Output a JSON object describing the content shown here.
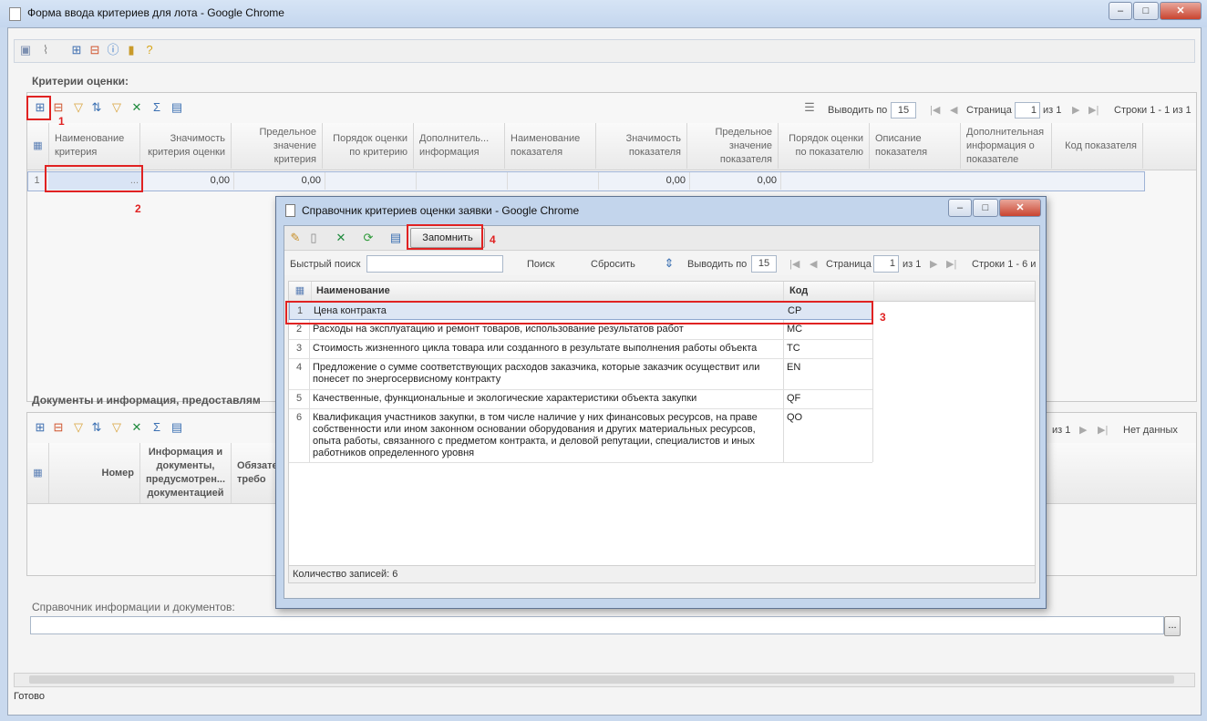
{
  "window": {
    "title": "Форма ввода критериев для лота - Google Chrome",
    "minimize": "–",
    "maximize": "□",
    "close": "✕"
  },
  "toolbar_icons": [
    "save-icon",
    "attach-icon",
    "add-row-icon",
    "delete-row-icon",
    "info-icon",
    "lock-icon",
    "help-icon"
  ],
  "criteria": {
    "title": "Критерии оценки:",
    "pager": {
      "show_label": "Выводить по",
      "show_value": "15",
      "page_label": "Страница",
      "page_value": "1",
      "of": "из 1",
      "rows": "Строки 1 - 1 из 1"
    },
    "columns": [
      "Наименование критерия",
      "Значимость критерия оценки",
      "Предельное значение критерия",
      "Порядок оценки по критерию",
      "Дополнитель... информация",
      "Наименование показателя",
      "Значимость показателя",
      "Предельное значение показателя",
      "Порядок оценки по показателю",
      "Описание показателя",
      "Дополнительная информация о показателе",
      "Код показателя"
    ],
    "row": {
      "num": "1",
      "name": "...",
      "significance": "0,00",
      "limit": "0,00",
      "ind_significance": "0,00",
      "ind_limit": "0,00"
    }
  },
  "documents": {
    "title": "Документы и информация, предоставлям",
    "pager": {
      "of": "из 1",
      "rows": "Нет данных"
    },
    "columns": [
      "Номер",
      "Информация и документы, предусмотрен... документацией",
      "Обязате... требо"
    ]
  },
  "reference": {
    "label": "Справочник информации и документов:",
    "button": "..."
  },
  "status": "Готово",
  "annotations": [
    "1",
    "2",
    "3",
    "4"
  ],
  "dialog": {
    "title": "Справочник критериев оценки заявки - Google Chrome",
    "remember_button": "Запомнить",
    "search_label": "Быстрый поиск",
    "search_value": "",
    "search_button": "Поиск",
    "reset_button": "Сбросить",
    "show_label": "Выводить по",
    "show_value": "15",
    "page_label": "Страница",
    "page_value": "1",
    "of": "из 1",
    "rows": "Строки 1 - 6 и",
    "col_name": "Наименование",
    "col_code": "Код",
    "items": [
      {
        "n": "1",
        "name": "Цена контракта",
        "code": "CP"
      },
      {
        "n": "2",
        "name": "Расходы на эксплуатацию и ремонт товаров, использование результатов работ",
        "code": "MC"
      },
      {
        "n": "3",
        "name": "Стоимость жизненного цикла товара или созданного в результате выполнения работы объекта",
        "code": "TC"
      },
      {
        "n": "4",
        "name": "Предложение о сумме соответствующих расходов заказчика, которые заказчик осуществит или понесет по энергосервисному контракту",
        "code": "EN"
      },
      {
        "n": "5",
        "name": "Качественные, функциональные и экологические характеристики объекта закупки",
        "code": "QF"
      },
      {
        "n": "6",
        "name": "Квалификация участников закупки, в том числе наличие у них финансовых ресурсов, на праве собственности или ином законном основании оборудования и других материальных ресурсов, опыта работы, связанного с предметом контракта, и деловой репутации, специалистов и иных работников определенного уровня",
        "code": "QO"
      }
    ],
    "count": "Количество записей: 6"
  }
}
